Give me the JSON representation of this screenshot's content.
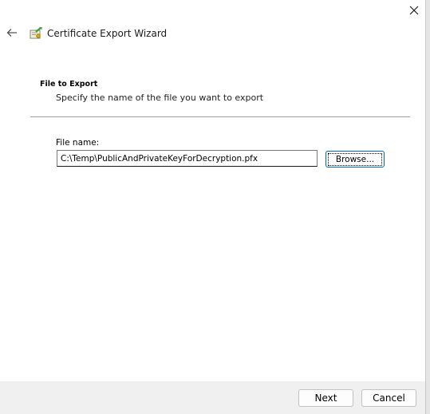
{
  "window": {
    "title": "Certificate Export Wizard",
    "close_icon": "close-icon",
    "back_icon": "back-arrow-icon",
    "app_icon": "certificate-icon"
  },
  "section": {
    "title": "File to Export",
    "description": "Specify the name of the file you want to export"
  },
  "file": {
    "label": "File name:",
    "value": "C:\\Temp\\PublicAndPrivateKeyForDecryption.pfx",
    "browse_label": "Browse..."
  },
  "footer": {
    "next_label": "Next",
    "cancel_label": "Cancel"
  },
  "colors": {
    "accent": "#0067c0",
    "footer_bg": "#f0f0f0",
    "divider": "#a0a0a0"
  }
}
